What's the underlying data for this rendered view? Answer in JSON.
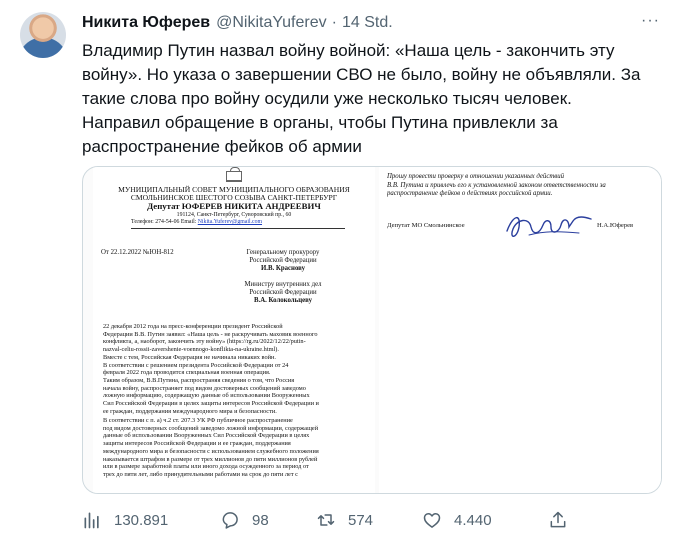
{
  "tweet": {
    "author_name": "Никита Юферев",
    "handle": "@NikitaYuferev",
    "separator": "·",
    "time": "14 Std.",
    "more": "···",
    "text_lines": [
      "Владимир Путин назвал войну войной: «Наша цель - закончить эту",
      "войну». Но указа о завершении СВО не было, войну не объявляли. За",
      "такие слова про войну осудили уже несколько тысяч человек.",
      "Направил обращение в органы, чтобы Путина  привлекли за",
      "распространение фейков об армии"
    ]
  },
  "document": {
    "left_page": {
      "org_line1": "МУНИЦИПАЛЬНЫЙ СОВЕТ МУНИЦИПАЛЬНОГО ОБРАЗОВАНИЯ",
      "org_line2": "СМОЛЬНИНСКОЕ ШЕСТОГО СОЗЫВА САНКТ-ПЕТЕРБУРГ",
      "deputy": "Депутат ЮФЕРЕВ НИКИТА АНДРЕЕВИЧ",
      "address": "191124, Санкт-Петербург, Суворовский пр., 60",
      "contact_prefix": "Телефон: 274-54-06 Email: ",
      "email": "Nikita.Yuferev@gmail.com",
      "outgoing_number": "От 22.12.2022 №ЮН-812",
      "recipient1": [
        "Генеральному прокурору",
        "Российской Федерации",
        "И.В. Краснову"
      ],
      "recipient2": [
        "Министру внутренних дел",
        "Российской Федерации",
        "В.А. Колокольцеву"
      ],
      "para1": [
        "         22 декабря 2012 года на пресс-конференции президент Российской",
        "Федерации В.В. Путин заявил: «Наша цель - не раскручивать маховик военного",
        "конфликта, а, наоборот, закончить эту войну» (https://rg.ru/2022/12/22/putin-",
        "nazval-celiu-rossii-zavershenie-voennogo-konflikta-na-ukraine.html)."
      ],
      "para2": [
        "         Вместе с тем, Российская Федерация не начинала никаких войн."
      ],
      "para3": [
        "         В соответствии с решением президента Российской Федерации от 24",
        "февраля 2022 года проводится специальная военная операция."
      ],
      "para4": [
        "         Таким образом, В.В.Путина, распространяя сведения о том, что Россия",
        "начала войну, распространяет под видом достоверных сообщений заведомо",
        "ложную информацию, содержащую данные об использовании Вооруженных",
        "Сил Российской Федерации в целях защиты интересов Российской Федерации и",
        "ее граждан, поддержания международного мира и безопасности."
      ],
      "para5": [
        "         В соответствии с п. а) ч.2 ст. 207.3 УК РФ публичное распространение",
        "под видом достоверных сообщений заведомо ложной информации, содержащей",
        "данные об использовании Вооруженных Сил Российской Федерации в целях",
        "защиты интересов Российской Федерации и ее граждан, поддержания",
        "международного мира и безопасности с использованием служебного положения",
        "наказывается штрафом в размере от трех миллионов до пяти миллионов рублей",
        "или в размере заработной платы или иного дохода осужденного за период от",
        "трех до пяти лет, либо принудительными работами на срок до пяти лет с"
      ]
    },
    "right_page": {
      "request_lines": [
        "         Прошу провести проверку в отношении указанных действий",
        "В.В. Путина и привлечь его к установленной законом ответственности за",
        "распространение фейков о действиях российской армии."
      ],
      "sign_left": "Депутат МО Смольнинское",
      "sign_right": "Н.А.Юферев"
    }
  },
  "actions": {
    "views": "130.891",
    "replies": "98",
    "retweets": "574",
    "likes": "4.440"
  },
  "colors": {
    "text": "#0f1419",
    "secondary": "#536471",
    "border": "#cfd9de",
    "link": "#1f3fbf"
  }
}
